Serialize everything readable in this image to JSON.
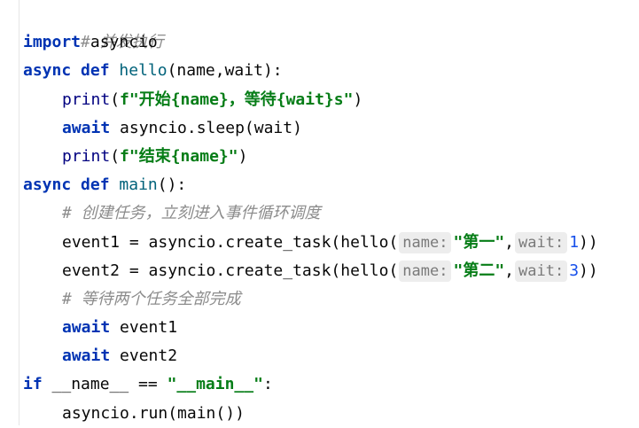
{
  "lines": [
    {
      "comment": "# 并发执行"
    },
    {
      "kw": "import",
      "rest": " asyncio"
    },
    {
      "kw1": "async",
      "kw2": "def",
      "name": "hello",
      "params": "(name,wait):"
    },
    {
      "fn": "print",
      "p1": "(",
      "fpre": "f\"",
      "s1": "开始",
      "v1": "{name}",
      "s2": "，等待",
      "v2": "{wait}",
      "s3": "s\"",
      "p2": ")"
    },
    {
      "kw": "await",
      "rest": " asyncio.sleep(wait)"
    },
    {
      "fn": "print",
      "p1": "(",
      "fpre": "f\"",
      "s1": "结束",
      "v1": "{name}",
      "s3": "\"",
      "p2": ")"
    },
    {
      "kw1": "async",
      "kw2": "def",
      "name": "main",
      "params": "():"
    },
    {
      "comment": "# 创建任务，立刻进入事件循环调度"
    },
    {
      "pre": "event1 = asyncio.create_task(hello(",
      "hint1": "name:",
      "arg1": "\"第一\"",
      "comma": ",",
      "hint2": "wait:",
      "arg2": "1",
      "post": "))"
    },
    {
      "pre": "event2 = asyncio.create_task(hello(",
      "hint1": "name:",
      "arg1": "\"第二\"",
      "comma": ",",
      "hint2": "wait:",
      "arg2": "3",
      "post": "))"
    },
    {
      "comment": "# 等待两个任务全部完成"
    },
    {
      "kw": "await",
      "rest": " event1"
    },
    {
      "kw": "await",
      "rest": " event2"
    },
    {
      "kw": "if",
      "rest1": " __name__ == ",
      "str": "\"__main__\"",
      "rest2": ":"
    },
    {
      "rest": "asyncio.run(main())"
    }
  ]
}
